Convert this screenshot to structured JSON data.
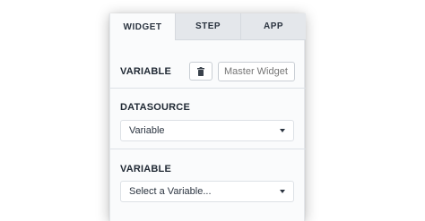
{
  "tabs": [
    {
      "label": "WIDGET",
      "active": true
    },
    {
      "label": "STEP",
      "active": false
    },
    {
      "label": "APP",
      "active": false
    }
  ],
  "variable_row": {
    "label": "VARIABLE",
    "trash_icon": "trash-icon",
    "name_placeholder": "Master Widget"
  },
  "datasource": {
    "label": "DATASOURCE",
    "selected": "Variable"
  },
  "variable_select": {
    "label": "VARIABLE",
    "selected": "Select a Variable..."
  },
  "colors": {
    "tab_bar": "#e4e7eb",
    "panel_bg": "#fafbfc",
    "text": "#1f2833",
    "placeholder": "#7a838d"
  }
}
